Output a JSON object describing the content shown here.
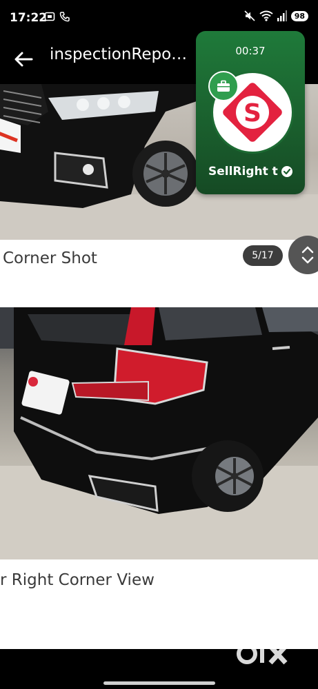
{
  "status_bar": {
    "time": "17:22",
    "battery": "98",
    "icons": [
      "screen-record-icon",
      "phone-call-icon",
      "mute-icon",
      "wifi-icon",
      "signal-icon"
    ]
  },
  "app_bar": {
    "title": "inspectionRepo…",
    "back_icon": "arrow-left-icon"
  },
  "gallery": {
    "items": [
      {
        "caption": "Corner Shot",
        "photo": "car-front-corner-photo"
      },
      {
        "caption": "r Right Corner View",
        "photo": "car-rear-right-corner-photo"
      }
    ],
    "page_indicator": "5/17"
  },
  "floating_video": {
    "timer": "00:37",
    "name": "SellRight t",
    "verified_icon": "verified-check-icon",
    "logo_letter": "S"
  },
  "brand": {
    "watermark": "OLX"
  },
  "colors": {
    "bar": "#000000",
    "video_card_green": "#1f7a3a",
    "logo_red": "#e3223f",
    "badge_gray": "#3d3d3d"
  }
}
